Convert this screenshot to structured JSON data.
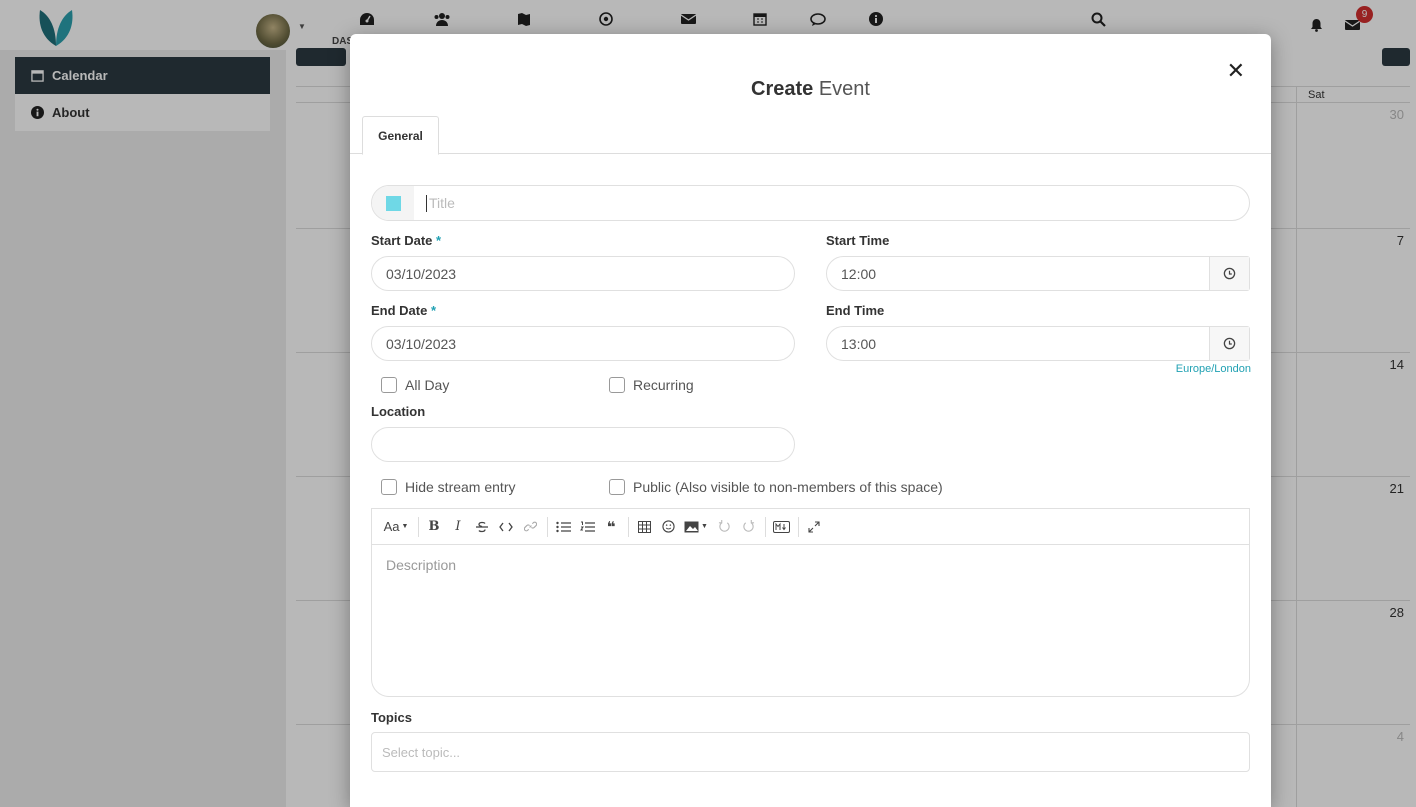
{
  "topnav": {
    "space_label": "DAS",
    "notification_count": "9"
  },
  "sidebar": {
    "items": [
      {
        "label": "Calendar",
        "icon": "calendar-icon",
        "active": true
      },
      {
        "label": "About",
        "icon": "info-icon",
        "active": false
      }
    ]
  },
  "calendar": {
    "header_day": "Sat",
    "day_numbers": [
      "30",
      "7",
      "14",
      "21",
      "28",
      "4"
    ]
  },
  "modal": {
    "title_bold": "Create",
    "title_rest": " Event",
    "tab_general": "General",
    "title_placeholder": "Title",
    "color": "#6fd8e6",
    "start_date_label": "Start Date",
    "start_date": "03/10/2023",
    "start_time_label": "Start Time",
    "start_time": "12:00",
    "end_date_label": "End Date",
    "end_date": "03/10/2023",
    "end_time_label": "End Time",
    "end_time": "13:00",
    "required_mark": "*",
    "timezone": "Europe/London",
    "all_day_label": "All Day",
    "recurring_label": "Recurring",
    "location_label": "Location",
    "location_value": "",
    "hide_stream_label": "Hide stream entry",
    "public_label": "Public (Also visible to non-members of this space)",
    "description_placeholder": "Description",
    "topics_label": "Topics",
    "topics_placeholder": "Select topic..."
  },
  "colors": {
    "accent": "#21a1b3",
    "sidebar_active": "#2b3a42",
    "badge": "#d32f2f"
  }
}
